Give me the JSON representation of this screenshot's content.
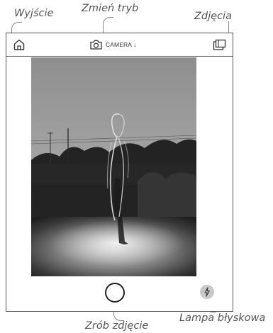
{
  "annotations": {
    "exit": "Wyjście",
    "change_mode": "Zmień tryb",
    "photos": "Zdjęcia",
    "capture": "Zrób zdjęcie",
    "flash": "Lampa błyskowa"
  },
  "topbar": {
    "home_icon": "home-icon",
    "mode_icon": "camera-icon",
    "mode_label": "CAMERA ↓",
    "gallery_icon": "gallery-icon"
  },
  "controls": {
    "shutter_icon": "shutter-circle-icon",
    "flash_icon": "lightning-bolt-icon"
  },
  "colors": {
    "frame": "#555555",
    "flash_button": "#c9c9c9"
  }
}
